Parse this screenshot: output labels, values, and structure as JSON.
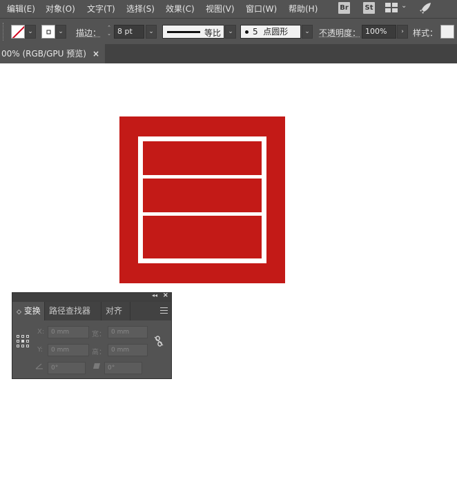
{
  "menu": {
    "items": [
      "编辑(E)",
      "对象(O)",
      "文字(T)",
      "选择(S)",
      "效果(C)",
      "视图(V)",
      "窗口(W)",
      "帮助(H)"
    ],
    "bridge_badge": "Br",
    "stock_badge": "St"
  },
  "control": {
    "stroke_label": "描边：",
    "stroke_weight": "8 pt",
    "stroke_profile": "等比",
    "brush_size": "5",
    "brush_name": "点圆形",
    "opacity_label": "不透明度：",
    "opacity_value": "100%",
    "style_label": "样式："
  },
  "document": {
    "tab_title": "00% (RGB/GPU 预览)",
    "close_glyph": "×"
  },
  "transform_panel": {
    "tabs": [
      "变换",
      "路径查找器",
      "对齐"
    ],
    "active_tab_arrow": "◇",
    "x_label": "X:",
    "x_value": "0 mm",
    "w_label": "宽：",
    "w_value": "0 mm",
    "y_label": "Y:",
    "y_value": "0 mm",
    "h_label": "高：",
    "h_value": "0 mm",
    "rotate_value": "0°",
    "shear_value": "0°"
  },
  "colors": {
    "artwork_red": "#c31a17",
    "chrome": "#535353",
    "canvas": "#ffffff"
  }
}
